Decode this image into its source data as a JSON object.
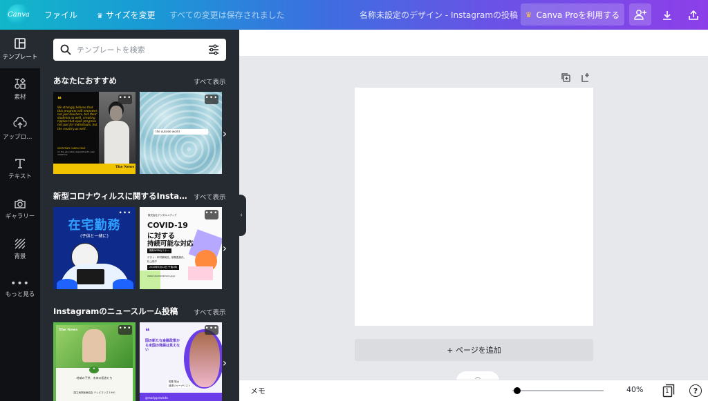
{
  "topbar": {
    "logo_text": "Canva",
    "file_menu": "ファイル",
    "resize_label": "サイズを変更",
    "save_status": "すべての変更は保存されました",
    "doc_title": "名称未設定のデザイン - Instagramの投稿",
    "pro_button": "Canva Proを利用する"
  },
  "sidenav": {
    "items": [
      {
        "label": "テンプレート",
        "icon": "template-icon"
      },
      {
        "label": "素材",
        "icon": "elements-icon"
      },
      {
        "label": "アップロード",
        "icon": "upload-icon"
      },
      {
        "label": "テキスト",
        "icon": "text-icon"
      },
      {
        "label": "ギャラリー",
        "icon": "camera-icon"
      },
      {
        "label": "背景",
        "icon": "background-icon"
      },
      {
        "label": "もっと見る",
        "icon": "more-icon"
      }
    ]
  },
  "panel": {
    "search_placeholder": "テンプレートを検索",
    "see_all": "すべて表示",
    "sections": [
      {
        "title": "あなたにおすすめ",
        "t1": {
          "quote": "We strongly believe that this program will empower, not just teachers, but their students as well, creating ripples that spell progress not just for individuals, but the country as well.",
          "author": "SECRETARY CADEN CRUZ",
          "affil": "on the education department's new initiatives",
          "brand": "The News"
        },
        "t2": {
          "search_text": "the outside world"
        }
      },
      {
        "title": "新型コロナウィルスに関するInstagram投稿",
        "t1": {
          "heading": "在宅勤務",
          "sub": "(子供と一緒に)"
        },
        "t2": {
          "company": "株式会社デジタルメディア",
          "heading_1": "COVID-19",
          "heading_2": "に対する",
          "heading_3": "持続可能な対応",
          "tag": "無料WEBセミナー",
          "guest": "ゲスト：年村美咲氏、新藤直美氏、",
          "guest2": "杉上祐子",
          "date_tag": "2020年5月14日 午後1時",
          "url": "www.futurewebinars.jp.jp"
        }
      },
      {
        "title": "Instagramのニュースルーム投稿",
        "t1": {
          "brand": "The News",
          "caption": "地域の子供、未来の医者たち",
          "footer": "国立病院医療協会 テレビマンズ 1990"
        },
        "t2": {
          "quote_mark": "❝",
          "headline": "国の新たな金融政策から米国の発展は見えない",
          "footer_name": "佐藤 雄太",
          "footer_role": "経済ジャーナリスト",
          "handle": "@reallygreatsite"
        }
      }
    ]
  },
  "canvas": {
    "add_page": "+ ページを追加"
  },
  "bottombar": {
    "memo": "メモ",
    "zoom": "40%",
    "page_count": "1"
  }
}
